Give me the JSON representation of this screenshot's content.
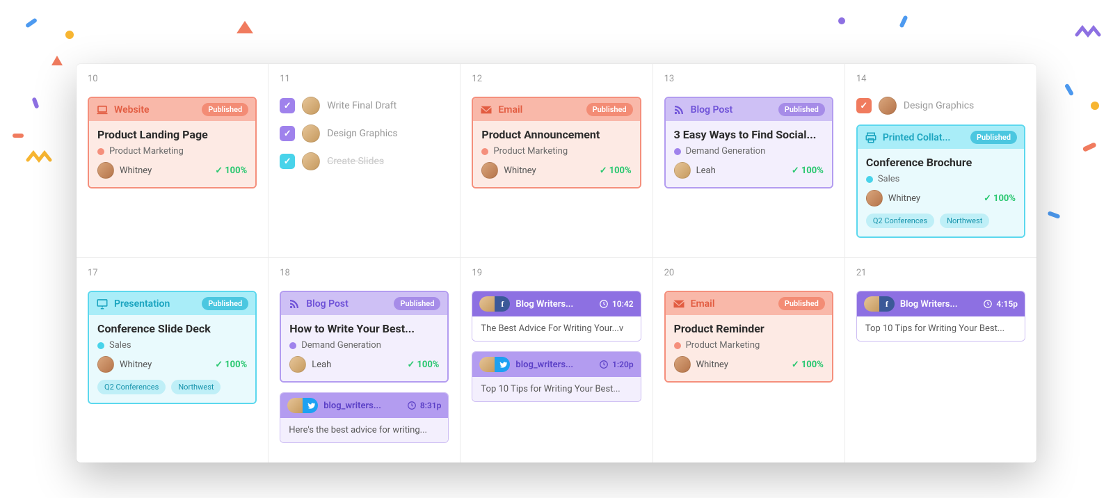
{
  "colors": {
    "orange": "#f58f7c",
    "purple": "#b39cf0",
    "cyan": "#5cd8ee",
    "green": "#28c76f"
  },
  "days": {
    "10": "10",
    "11": "11",
    "12": "12",
    "13": "13",
    "14": "14",
    "17": "17",
    "18": "18",
    "19": "19",
    "20": "20",
    "21": "21"
  },
  "labels": {
    "published": "Published"
  },
  "types": {
    "website": "Website",
    "email": "Email",
    "blog": "Blog Post",
    "printed": "Printed Collat...",
    "presentation": "Presentation"
  },
  "categories": {
    "product_marketing": "Product Marketing",
    "demand_gen": "Demand Generation",
    "sales": "Sales"
  },
  "people": {
    "whitney": "Whitney",
    "leah": "Leah"
  },
  "pct100": "100%",
  "tags": {
    "q2": "Q2 Conferences",
    "nw": "Northwest"
  },
  "cards": {
    "c10": {
      "title": "Product Landing Page"
    },
    "c12": {
      "title": "Product Announcement"
    },
    "c13": {
      "title": "3 Easy Ways to Find Social..."
    },
    "c14b": {
      "title": "Conference Brochure"
    },
    "c17": {
      "title": "Conference Slide Deck"
    },
    "c18": {
      "title": "How to Write Your Best..."
    },
    "c20": {
      "title": "Product Reminder"
    }
  },
  "tasks": {
    "d11a": "Write Final Draft",
    "d11b": "Design Graphics",
    "d11c": "Create Slides",
    "d14a": "Design Graphics"
  },
  "social": {
    "s18": {
      "account": "blog_writers...",
      "time": "8:31p",
      "text": "Here's the best advice for writing..."
    },
    "s19a": {
      "account": "Blog Writers...",
      "time": "10:42",
      "text": "The Best Advice For Writing Your...v"
    },
    "s19b": {
      "account": "blog_writers...",
      "time": "1:20p",
      "text": "Top 10 Tips for Writing Your Best..."
    },
    "s21": {
      "account": "Blog Writers...",
      "time": "4:15p",
      "text": "Top 10 Tips for Writing Your Best..."
    }
  }
}
